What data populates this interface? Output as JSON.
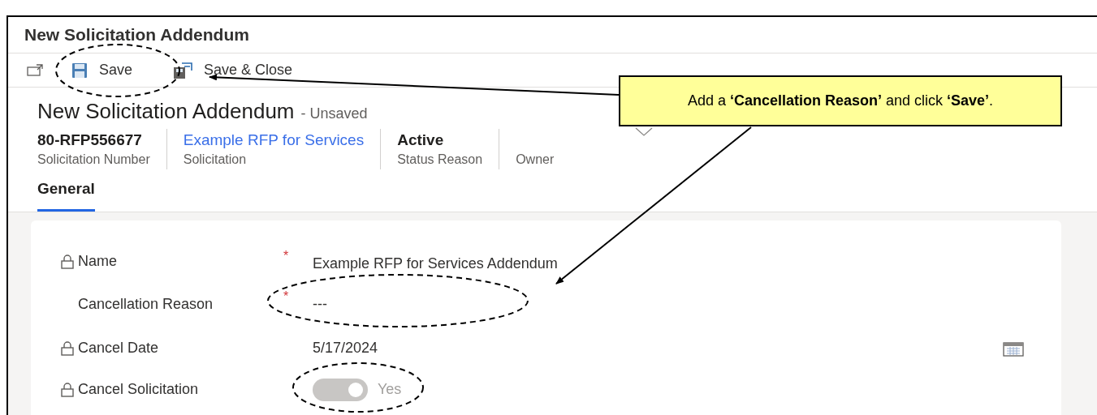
{
  "window": {
    "title": "New Solicitation Addendum"
  },
  "toolbar": [
    {
      "kind": "popout"
    },
    {
      "kind": "save",
      "label": "Save"
    },
    {
      "kind": "save_close",
      "label": "Save & Close"
    }
  ],
  "record": {
    "title": "New Solicitation Addendum",
    "status": "- Unsaved"
  },
  "header_fields": [
    {
      "kind": "text",
      "value": "80-RFP556677",
      "label": "Solicitation Number"
    },
    {
      "kind": "link",
      "value": "Example RFP for Services",
      "label": "Solicitation"
    },
    {
      "kind": "text",
      "value": "Active",
      "label": "Status Reason"
    },
    {
      "kind": "dropdown",
      "label": "Owner"
    }
  ],
  "tabs": [
    {
      "label": "General",
      "selected": true
    }
  ],
  "fields": [
    {
      "kind": "text",
      "label": "Name",
      "locked": true,
      "required_mark": "*",
      "value": "Example RFP for Services Addendum"
    },
    {
      "kind": "text",
      "label": "Cancellation Reason",
      "locked": false,
      "required_mark": "*",
      "value": "---"
    },
    {
      "kind": "date",
      "label": "Cancel Date",
      "locked": true,
      "value": "5/17/2024"
    },
    {
      "kind": "toggle",
      "label": "Cancel Solicitation",
      "locked": true,
      "on": true,
      "disabled": true,
      "value": "Yes"
    }
  ],
  "callout": {
    "text": "Add a **‘Cancellation Reason’** and click **‘Save’**."
  }
}
